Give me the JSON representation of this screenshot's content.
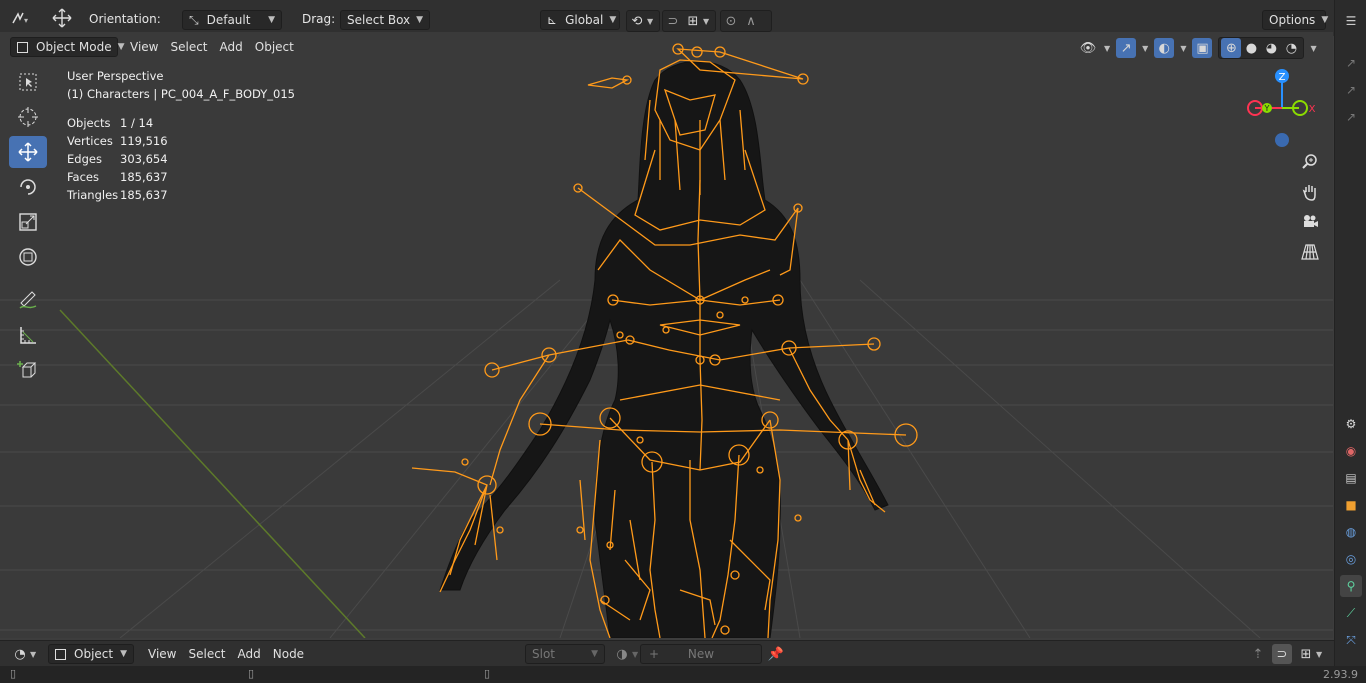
{
  "top_header": {
    "orientation_label": "Orientation:",
    "orientation_value": "Default",
    "drag_label": "Drag:",
    "drag_value": "Select Box",
    "transform_space": "Global",
    "options_label": "Options"
  },
  "viewport_header": {
    "mode": "Object Mode",
    "menus": [
      "View",
      "Select",
      "Add",
      "Object"
    ]
  },
  "overlay": {
    "perspective": "User Perspective",
    "context": "(1) Characters | PC_004_A_F_BODY_015",
    "stats": [
      {
        "label": "Objects",
        "value": "1 / 14"
      },
      {
        "label": "Vertices",
        "value": "119,516"
      },
      {
        "label": "Edges",
        "value": "303,654"
      },
      {
        "label": "Faces",
        "value": "185,637"
      },
      {
        "label": "Triangles",
        "value": "185,637"
      }
    ]
  },
  "gizmo": {
    "z": "Z",
    "y": "Y",
    "x": "X"
  },
  "bottom_header": {
    "editor_type": "Object",
    "menus": [
      "View",
      "Select",
      "Add",
      "Node"
    ],
    "slot_label": "Slot",
    "new_label": "New"
  },
  "status": {
    "version": "2.93.9"
  },
  "colors": {
    "bone": "#ff9a1a",
    "active": "#4772b3",
    "axis_x": "#ff3352",
    "axis_y": "#8bdc00",
    "axis_z": "#2890ff"
  }
}
